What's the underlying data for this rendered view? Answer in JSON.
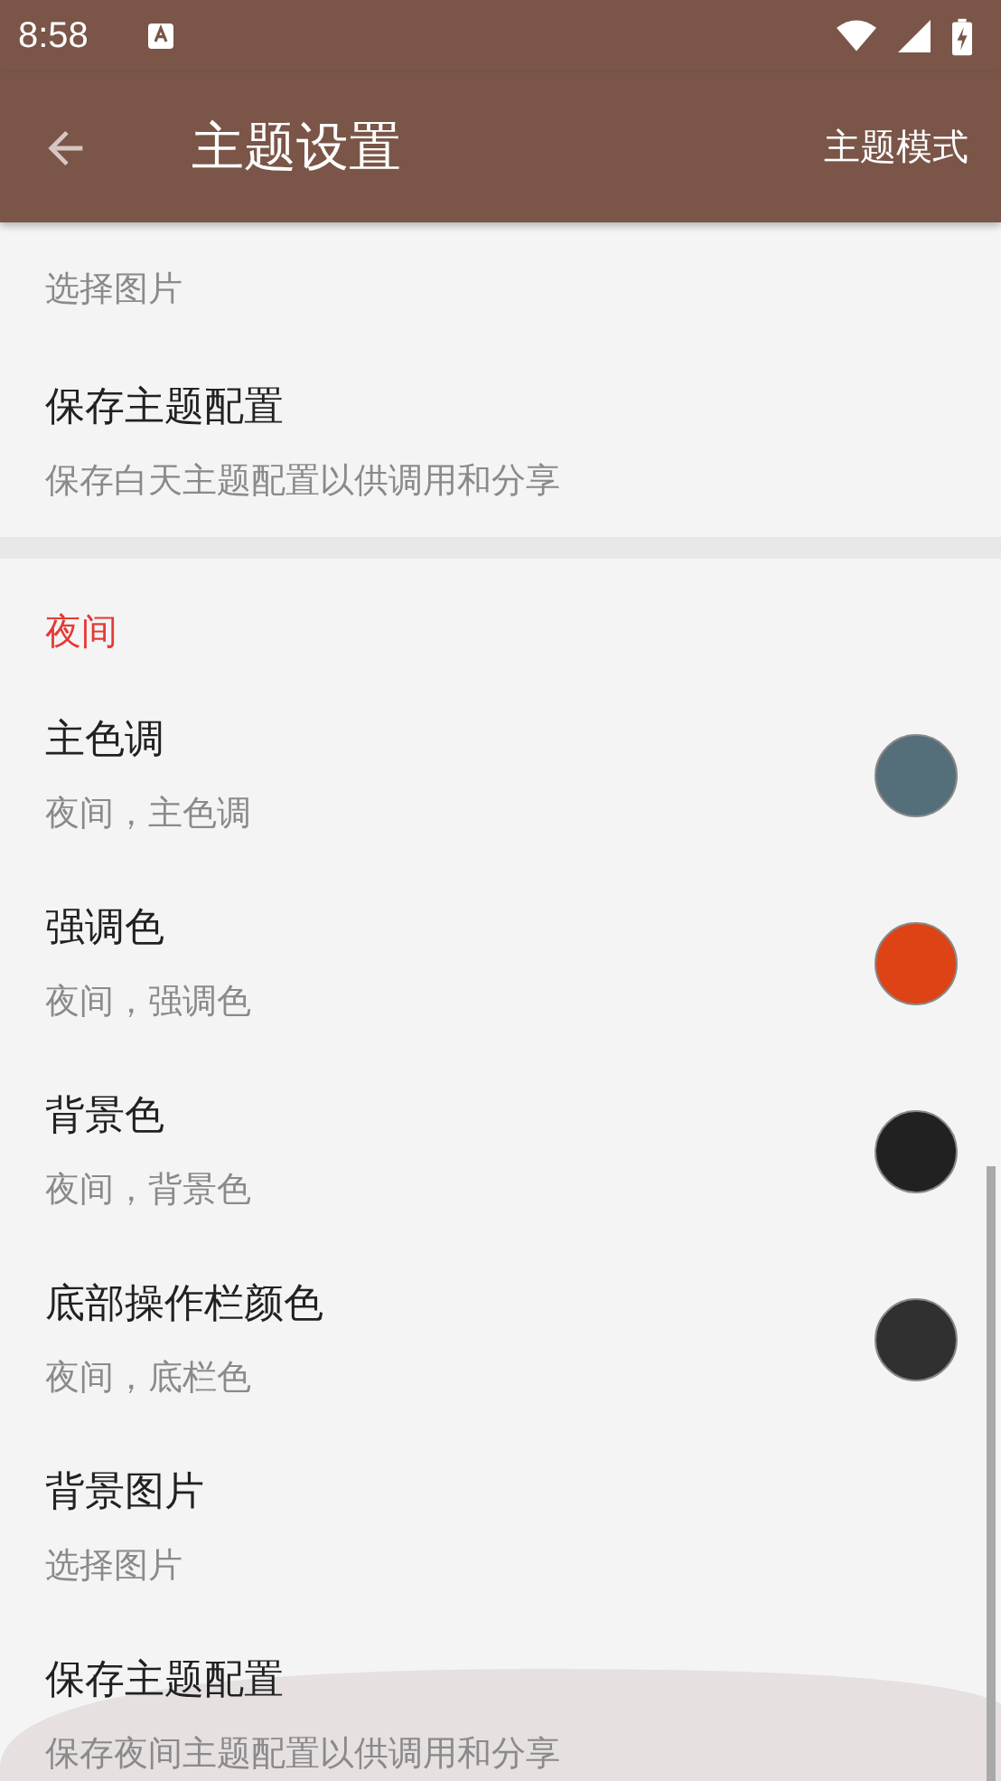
{
  "status_bar": {
    "time": "8:58"
  },
  "toolbar": {
    "title": "主题设置",
    "action": "主题模式"
  },
  "sections": [
    {
      "items": [
        {
          "kind": "action",
          "subtitle": "选择图片"
        },
        {
          "kind": "action",
          "title": "保存主题配置",
          "subtitle": "保存白天主题配置以供调用和分享"
        }
      ]
    },
    {
      "header": "夜间",
      "items": [
        {
          "kind": "color",
          "title": "主色调",
          "subtitle": "夜间，主色调",
          "color": "#546e7a"
        },
        {
          "kind": "color",
          "title": "强调色",
          "subtitle": "夜间，强调色",
          "color": "#dd4314"
        },
        {
          "kind": "color",
          "title": "背景色",
          "subtitle": "夜间，背景色",
          "color": "#212121"
        },
        {
          "kind": "color",
          "title": "底部操作栏颜色",
          "subtitle": "夜间，底栏色",
          "color": "#303030"
        },
        {
          "kind": "action",
          "title": "背景图片",
          "subtitle": "选择图片"
        },
        {
          "kind": "action",
          "title": "保存主题配置",
          "subtitle": "保存夜间主题配置以供调用和分享"
        }
      ]
    }
  ]
}
